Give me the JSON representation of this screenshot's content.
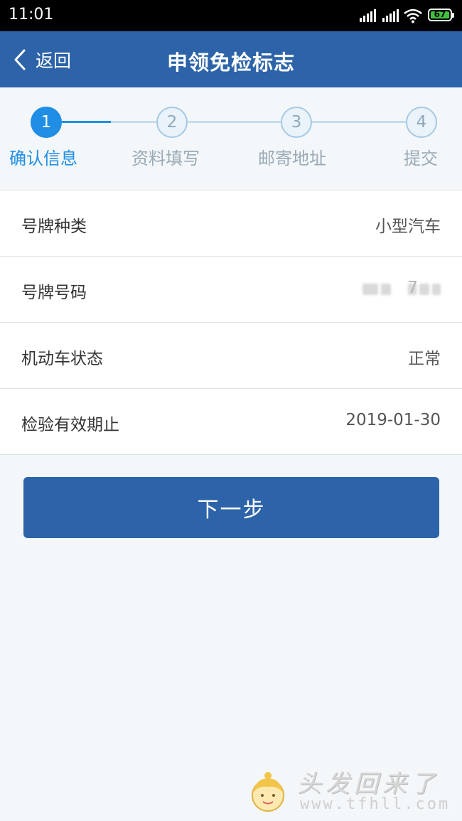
{
  "status_bar": {
    "time": "11:01",
    "battery": "67"
  },
  "header": {
    "back_label": "返回",
    "title": "申领免检标志"
  },
  "stepper": {
    "current_step": 1,
    "steps": [
      {
        "number": "1",
        "label": "确认信息",
        "state": "active"
      },
      {
        "number": "2",
        "label": "资料填写",
        "state": "inactive"
      },
      {
        "number": "3",
        "label": "邮寄地址",
        "state": "inactive"
      },
      {
        "number": "4",
        "label": "提交",
        "state": "inactive"
      }
    ]
  },
  "info": {
    "rows": [
      {
        "label": "号牌种类",
        "value": "小型汽车"
      },
      {
        "label": "号牌号码",
        "value": "7"
      },
      {
        "label": "机动车状态",
        "value": "正常"
      },
      {
        "label": "检验有效期止",
        "value": "2019-01-30"
      }
    ]
  },
  "actions": {
    "next_label": "下一步"
  },
  "watermark": {
    "text": "头发回来了",
    "url": "www.tfhll.com"
  },
  "colors": {
    "primary": "#2d64a9",
    "accent": "#1f8ee4",
    "background": "#f3f7f9"
  }
}
